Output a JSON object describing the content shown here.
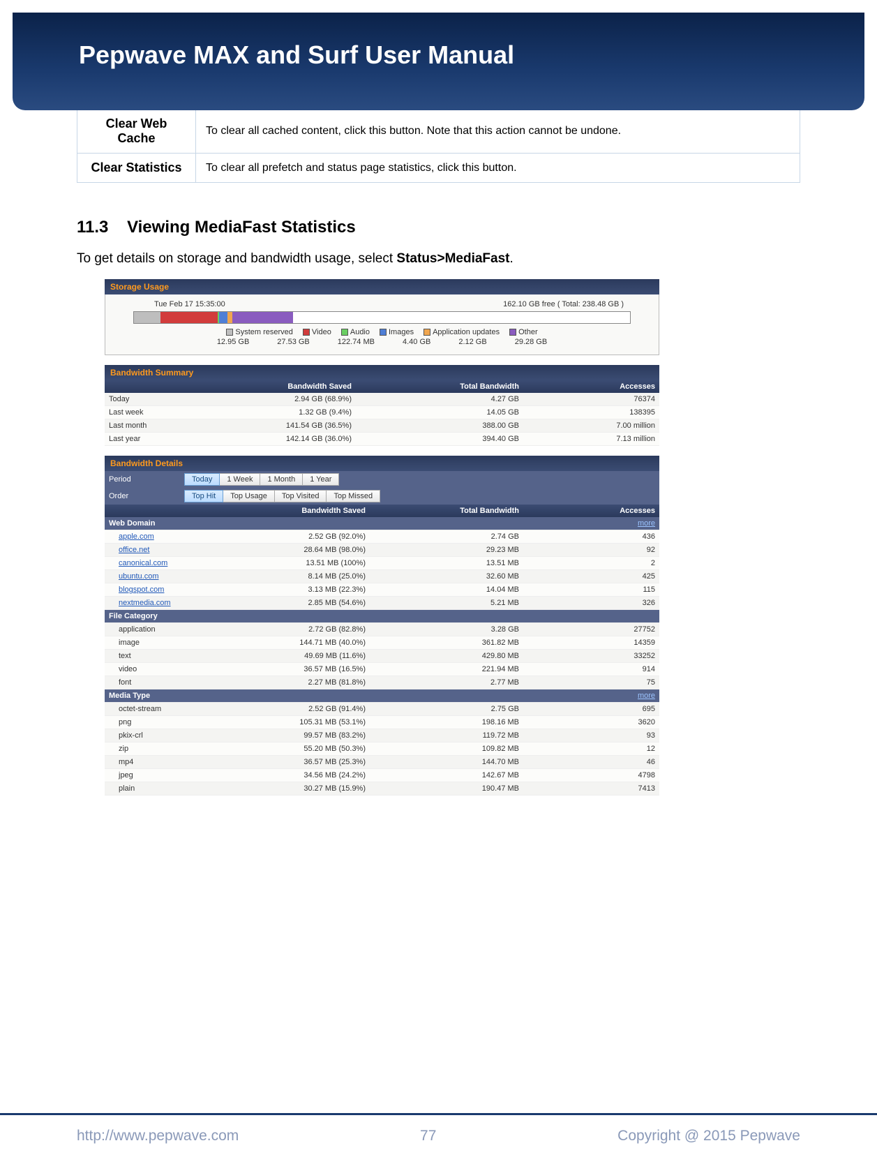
{
  "header": {
    "title": "Pepwave MAX and Surf User Manual"
  },
  "def_table": [
    {
      "term": "Clear Web Cache",
      "desc": "To clear all cached content, click this button. Note that this action cannot be undone."
    },
    {
      "term": "Clear Statistics",
      "desc": "To clear all prefetch and status page statistics, click this button."
    }
  ],
  "section": {
    "number": "11.3",
    "title": "Viewing MediaFast Statistics",
    "intro_pre": "To get details on storage and bandwidth usage, select ",
    "intro_bold": "Status>MediaFast",
    "intro_post": "."
  },
  "storage": {
    "panel_title": "Storage Usage",
    "timestamp": "Tue Feb 17 15:35:00",
    "free_text": "162.10 GB free ( Total: 238.48 GB )",
    "segments": [
      {
        "name": "System reserved",
        "value": "12.95 GB",
        "color": "#bebebe",
        "pct": 5.4
      },
      {
        "name": "Video",
        "value": "27.53 GB",
        "color": "#d23c3c",
        "pct": 11.5
      },
      {
        "name": "Audio",
        "value": "122.74 MB",
        "color": "#6bcf63",
        "pct": 0.2
      },
      {
        "name": "Images",
        "value": "4.40 GB",
        "color": "#4f7fd6",
        "pct": 1.8
      },
      {
        "name": "Application updates",
        "value": "2.12 GB",
        "color": "#f0a64f",
        "pct": 0.9
      },
      {
        "name": "Other",
        "value": "29.28 GB",
        "color": "#8a5cbf",
        "pct": 12.3
      }
    ],
    "free_pct": 67.9
  },
  "bandwidth_summary": {
    "panel_title": "Bandwidth Summary",
    "headers": [
      "",
      "Bandwidth Saved",
      "Total Bandwidth",
      "Accesses"
    ],
    "rows": [
      {
        "period": "Today",
        "saved": "2.94 GB (68.9%)",
        "total": "4.27 GB",
        "accesses": "76374"
      },
      {
        "period": "Last week",
        "saved": "1.32 GB (9.4%)",
        "total": "14.05 GB",
        "accesses": "138395"
      },
      {
        "period": "Last month",
        "saved": "141.54 GB (36.5%)",
        "total": "388.00 GB",
        "accesses": "7.00 million"
      },
      {
        "period": "Last year",
        "saved": "142.14 GB (36.0%)",
        "total": "394.40 GB",
        "accesses": "7.13 million"
      }
    ]
  },
  "bandwidth_details": {
    "panel_title": "Bandwidth Details",
    "period_label": "Period",
    "order_label": "Order",
    "period_buttons": [
      "Today",
      "1 Week",
      "1 Month",
      "1 Year"
    ],
    "order_buttons": [
      "Top Hit",
      "Top Usage",
      "Top Visited",
      "Top Missed"
    ],
    "period_active": 0,
    "order_active": 0,
    "headers": [
      "",
      "Bandwidth Saved",
      "Total Bandwidth",
      "Accesses"
    ],
    "more_label": "more",
    "groups": [
      {
        "name": "Web Domain",
        "has_more": true,
        "link_rows": true,
        "rows": [
          {
            "name": "apple.com",
            "saved": "2.52 GB (92.0%)",
            "total": "2.74 GB",
            "accesses": "436"
          },
          {
            "name": "office.net",
            "saved": "28.64 MB (98.0%)",
            "total": "29.23 MB",
            "accesses": "92"
          },
          {
            "name": "canonical.com",
            "saved": "13.51 MB (100%)",
            "total": "13.51 MB",
            "accesses": "2"
          },
          {
            "name": "ubuntu.com",
            "saved": "8.14 MB (25.0%)",
            "total": "32.60 MB",
            "accesses": "425"
          },
          {
            "name": "blogspot.com",
            "saved": "3.13 MB (22.3%)",
            "total": "14.04 MB",
            "accesses": "115"
          },
          {
            "name": "nextmedia.com",
            "saved": "2.85 MB (54.6%)",
            "total": "5.21 MB",
            "accesses": "326"
          }
        ]
      },
      {
        "name": "File Category",
        "has_more": false,
        "link_rows": false,
        "rows": [
          {
            "name": "application",
            "saved": "2.72 GB (82.8%)",
            "total": "3.28 GB",
            "accesses": "27752"
          },
          {
            "name": "image",
            "saved": "144.71 MB (40.0%)",
            "total": "361.82 MB",
            "accesses": "14359"
          },
          {
            "name": "text",
            "saved": "49.69 MB (11.6%)",
            "total": "429.80 MB",
            "accesses": "33252"
          },
          {
            "name": "video",
            "saved": "36.57 MB (16.5%)",
            "total": "221.94 MB",
            "accesses": "914"
          },
          {
            "name": "font",
            "saved": "2.27 MB (81.8%)",
            "total": "2.77 MB",
            "accesses": "75"
          }
        ]
      },
      {
        "name": "Media Type",
        "has_more": true,
        "link_rows": false,
        "rows": [
          {
            "name": "octet-stream",
            "saved": "2.52 GB (91.4%)",
            "total": "2.75 GB",
            "accesses": "695"
          },
          {
            "name": "png",
            "saved": "105.31 MB (53.1%)",
            "total": "198.16 MB",
            "accesses": "3620"
          },
          {
            "name": "pkix-crl",
            "saved": "99.57 MB (83.2%)",
            "total": "119.72 MB",
            "accesses": "93"
          },
          {
            "name": "zip",
            "saved": "55.20 MB (50.3%)",
            "total": "109.82 MB",
            "accesses": "12"
          },
          {
            "name": "mp4",
            "saved": "36.57 MB (25.3%)",
            "total": "144.70 MB",
            "accesses": "46"
          },
          {
            "name": "jpeg",
            "saved": "34.56 MB (24.2%)",
            "total": "142.67 MB",
            "accesses": "4798"
          },
          {
            "name": "plain",
            "saved": "30.27 MB (15.9%)",
            "total": "190.47 MB",
            "accesses": "7413"
          }
        ]
      }
    ]
  },
  "footer": {
    "url": "http://www.pepwave.com",
    "page": "77",
    "copyright": "Copyright @ 2015 Pepwave"
  }
}
